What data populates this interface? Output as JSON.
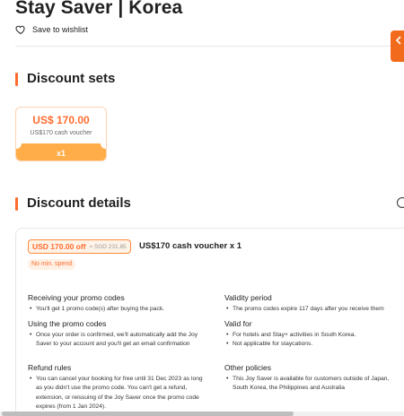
{
  "page": {
    "title": "Stay Saver | Korea",
    "wishlist_label": "Save to wishlist"
  },
  "discount_sets": {
    "heading": "Discount sets",
    "voucher": {
      "price": "US$ 170.00",
      "description": "US$170 cash voucher",
      "quantity": "x1"
    }
  },
  "discount_details": {
    "heading": "Discount details",
    "badge_off": "USD 170.00 off",
    "badge_was": "≈ SGD 231.85",
    "cash_title": "US$170 cash voucher x 1",
    "min_spend": "No min. spend"
  },
  "policies": {
    "receiving": {
      "title": "Receiving your promo codes",
      "items": [
        "You'll get 1 promo code(s) after buying the pack."
      ]
    },
    "using": {
      "title": "Using the promo codes",
      "items": [
        "Once your order is confirmed, we'll automatically add the Joy Saver to your account and you'll get an email confirmation"
      ]
    },
    "refund": {
      "title": "Refund rules",
      "items": [
        "You can cancel your booking for free until 31 Dec 2023 as long as you didn't use the promo code. You can't get a refund, extension, or reissuing of the Joy Saver once the promo code expires (from 1 Jan 2024)."
      ]
    },
    "validity": {
      "title": "Validity period",
      "items": [
        "The promo codes expire 117 days after you receive them"
      ]
    },
    "valid_for": {
      "title": "Valid for",
      "items": [
        "For hotels and Stay+ activities in South Korea.",
        "Not applicable for staycations."
      ]
    },
    "other": {
      "title": "Other policies",
      "items": [
        "This Joy Saver is available for customers outside of Japan, South Korea, the Philippines and Australia"
      ]
    }
  },
  "colors": {
    "accent": "#ff6c2f",
    "voucher_band": "#ffad48"
  },
  "icons": {
    "wishlist": "heart-outline-icon",
    "info": "info-circle-icon",
    "side_tab": "chevron-left-icon"
  }
}
